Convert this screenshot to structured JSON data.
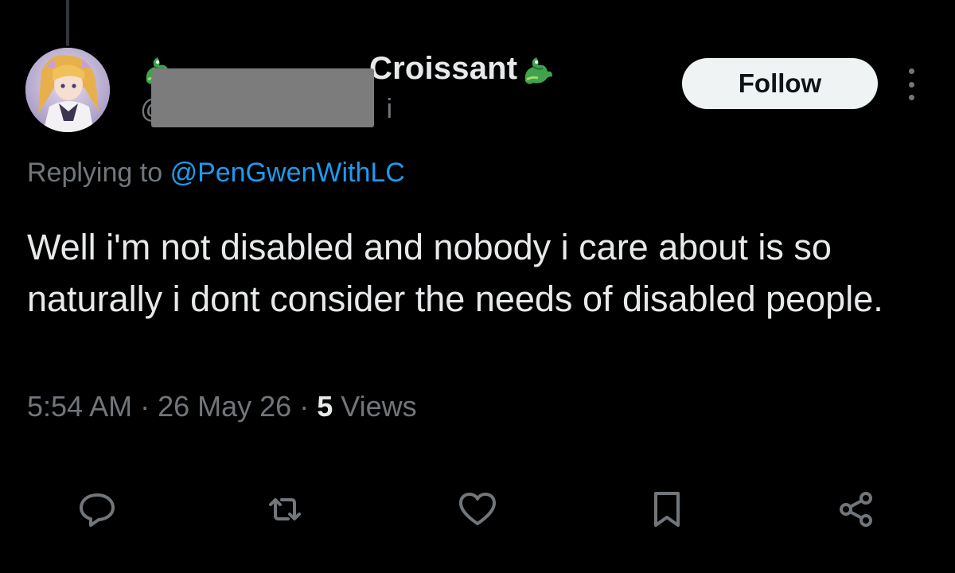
{
  "author": {
    "display_name": "Croissant",
    "handle_visible": "@",
    "handle_tail": "i",
    "badge_icons": [
      "dragon-icon",
      "dragon-icon"
    ],
    "avatar": "anime-avatar"
  },
  "follow_label": "Follow",
  "reply_context": {
    "prefix": "Replying to",
    "mention": "@PenGwenWithLC"
  },
  "tweet_text": "Well i'm not disabled and nobody i care about is so naturally i dont consider the needs of disabled people.",
  "meta": {
    "time": "5:54 AM",
    "sep1": " · ",
    "date": "26 May 26",
    "sep2": " · ",
    "views_count": "5",
    "views_label": " Views"
  },
  "actions": [
    {
      "name": "reply",
      "icon": "reply-icon"
    },
    {
      "name": "retweet",
      "icon": "retweet-icon"
    },
    {
      "name": "like",
      "icon": "heart-icon"
    },
    {
      "name": "bookmark",
      "icon": "bookmark-icon"
    },
    {
      "name": "share",
      "icon": "share-icon"
    }
  ],
  "colors": {
    "background": "#000000",
    "text": "#e7e9ea",
    "secondary": "#71767b",
    "link": "#1d9bf0",
    "follow_bg": "#eff3f4",
    "redaction": "#7c7c7c"
  }
}
